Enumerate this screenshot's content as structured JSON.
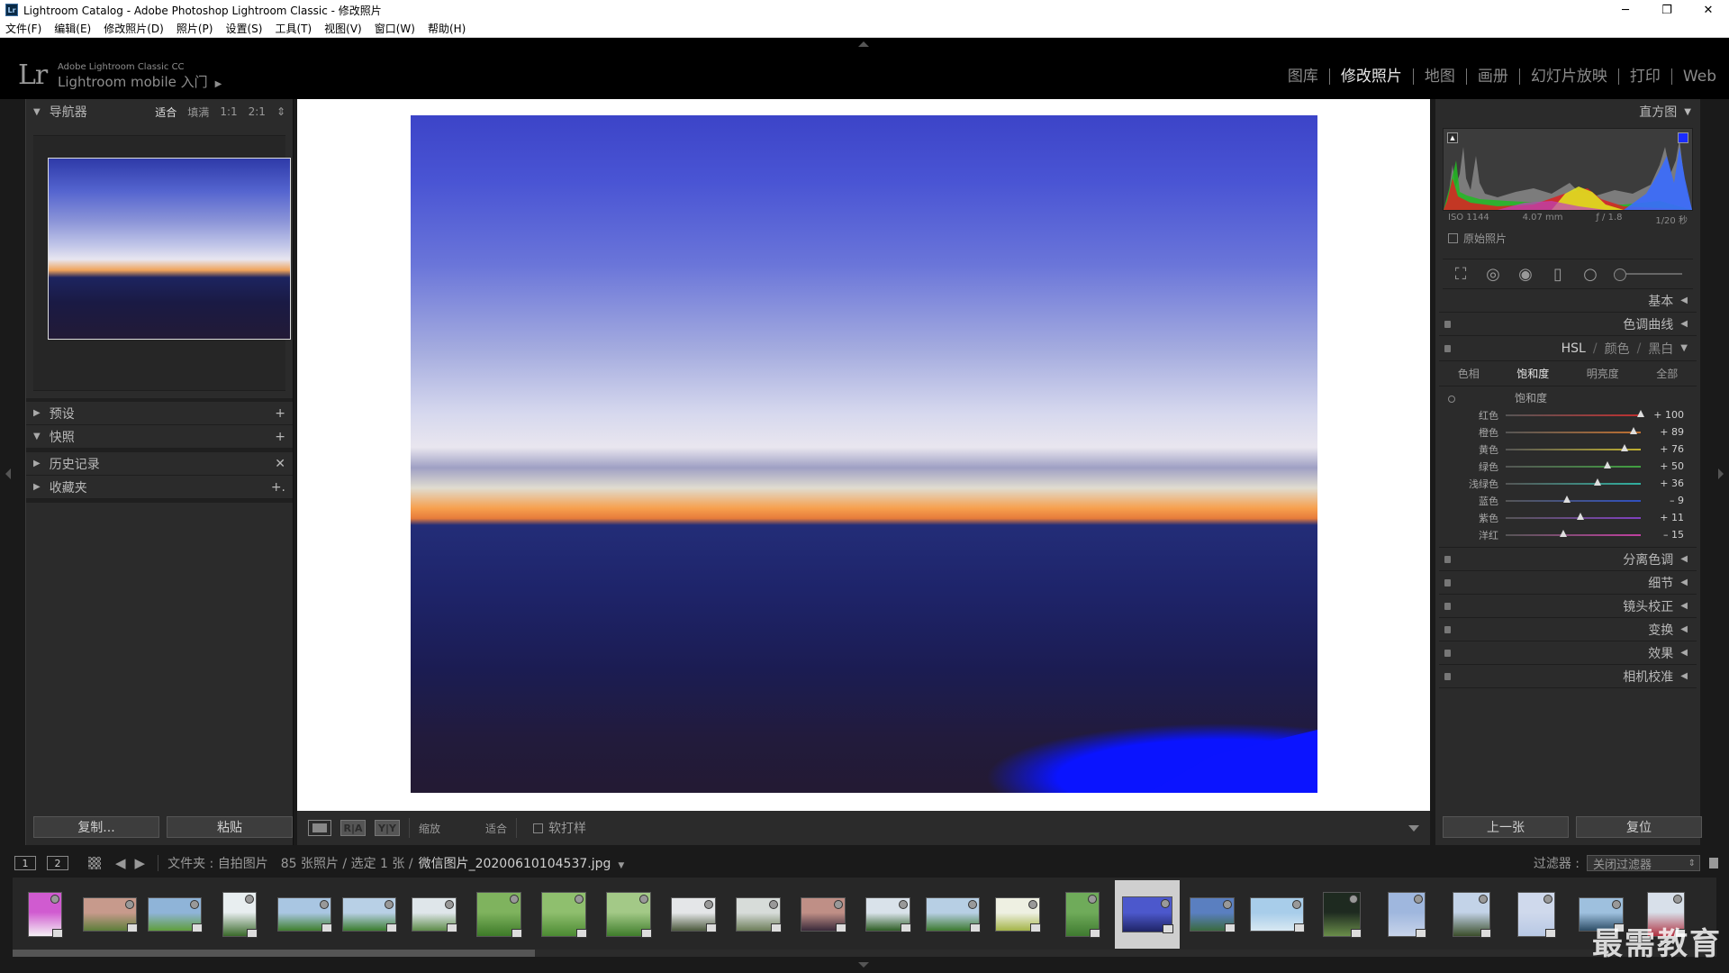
{
  "window": {
    "badge": "Lr",
    "title": "Lightroom Catalog - Adobe Photoshop Lightroom Classic - 修改照片",
    "min": "─",
    "max": "❐",
    "close": "✕"
  },
  "menu": [
    "文件(F)",
    "编辑(E)",
    "修改照片(D)",
    "照片(P)",
    "设置(S)",
    "工具(T)",
    "视图(V)",
    "窗口(W)",
    "帮助(H)"
  ],
  "identity": {
    "logo": "Lr",
    "line1": "Adobe Lightroom Classic CC",
    "line2": "Lightroom mobile 入门",
    "arrow": "▶"
  },
  "modules": [
    {
      "label": "图库",
      "active": false
    },
    {
      "label": "修改照片",
      "active": true
    },
    {
      "label": "地图",
      "active": false
    },
    {
      "label": "画册",
      "active": false
    },
    {
      "label": "幻灯片放映",
      "active": false
    },
    {
      "label": "打印",
      "active": false
    },
    {
      "label": "Web",
      "active": false
    }
  ],
  "left": {
    "navigator": {
      "title": "导航器",
      "tri": "▼",
      "opts": [
        "适合",
        "填满",
        "1:1",
        "2:1"
      ],
      "spin": "⇕"
    },
    "sections": [
      {
        "title": "预设",
        "tri": "▶",
        "action": "+"
      },
      {
        "title": "快照",
        "tri": "▼",
        "action": "+"
      },
      {
        "title": "历史记录",
        "tri": "▶",
        "action": "✕"
      },
      {
        "title": "收藏夹",
        "tri": "▶",
        "action": "+."
      }
    ],
    "copy_button": "复制...",
    "paste_button": "粘贴"
  },
  "toolbar": {
    "box1": "R|A",
    "box2": "Y|Y",
    "zoom_label": "缩放",
    "zoom_value": "适合",
    "softproof": "软打样"
  },
  "right": {
    "histogram": {
      "title": "直方图",
      "tri": "▼",
      "iso": "ISO 1144",
      "focal": "4.07 mm",
      "aperture": "ƒ / 1.8",
      "shutter": "1/20 秒",
      "original": "原始照片"
    },
    "sections_top": [
      {
        "title": "基本",
        "tri": "◀"
      },
      {
        "title": "色调曲线",
        "tri": "◀"
      }
    ],
    "hsl": {
      "labels": [
        "HSL",
        "颜色",
        "黑白"
      ],
      "tri": "▼",
      "tabs": [
        "色相",
        "饱和度",
        "明亮度",
        "全部"
      ],
      "active_tab": 1,
      "sub": "饱和度",
      "sliders": [
        {
          "label": "红色",
          "value": "+ 100",
          "v": 100,
          "color": "#c03030"
        },
        {
          "label": "橙色",
          "value": "+ 89",
          "v": 89,
          "color": "#c07030"
        },
        {
          "label": "黄色",
          "value": "+ 76",
          "v": 76,
          "color": "#c0b030"
        },
        {
          "label": "绿色",
          "value": "+ 50",
          "v": 50,
          "color": "#40a040"
        },
        {
          "label": "浅绿色",
          "value": "+ 36",
          "v": 36,
          "color": "#30b0a0"
        },
        {
          "label": "蓝色",
          "value": "– 9",
          "v": -9,
          "color": "#3050c0"
        },
        {
          "label": "紫色",
          "value": "+ 11",
          "v": 11,
          "color": "#8040c0"
        },
        {
          "label": "洋红",
          "value": "– 15",
          "v": -15,
          "color": "#c040a0"
        }
      ]
    },
    "sections_bottom": [
      {
        "title": "分离色调",
        "tri": "◀"
      },
      {
        "title": "细节",
        "tri": "◀"
      },
      {
        "title": "镜头校正",
        "tri": "◀"
      },
      {
        "title": "变换",
        "tri": "◀"
      },
      {
        "title": "效果",
        "tri": "◀"
      },
      {
        "title": "相机校准",
        "tri": "◀"
      }
    ],
    "prev_button": "上一张",
    "reset_button": "复位"
  },
  "filmstrip_header": {
    "screen1": "1",
    "screen2": "2",
    "back": "◀",
    "forward": "▶",
    "path": "文件夹 : 自拍图片",
    "count": "85 张照片 / 选定 1 张 /",
    "file": "微信图片_20200610104537.jpg",
    "file_tri": "▼",
    "filter_label": "过滤器 :",
    "filter_value": "关闭过滤器",
    "filter_spin": "⇕"
  },
  "filmstrip": {
    "selected_index": 17,
    "thumbs": [
      {
        "w": 38,
        "h": 50,
        "c1": "#d05bd0",
        "c2": "#f4f0f4"
      },
      {
        "w": 60,
        "h": 38,
        "c1": "#c79a8c",
        "c2": "#5d7e3a"
      },
      {
        "w": 60,
        "h": 38,
        "c1": "#8fb4d8",
        "c2": "#5f9e3c"
      },
      {
        "w": 38,
        "h": 50,
        "c1": "#e8eef0",
        "c2": "#3a6a2a"
      },
      {
        "w": 60,
        "h": 38,
        "c1": "#a9c6e2",
        "c2": "#3f7f2e"
      },
      {
        "w": 60,
        "h": 38,
        "c1": "#b8d0e6",
        "c2": "#3b7d2f"
      },
      {
        "w": 50,
        "h": 38,
        "c1": "#dfe6ea",
        "c2": "#5e8c4a"
      },
      {
        "w": 50,
        "h": 50,
        "c1": "#7fb35e",
        "c2": "#3d7a28"
      },
      {
        "w": 50,
        "h": 50,
        "c1": "#8fbf6e",
        "c2": "#4b8a32"
      },
      {
        "w": 50,
        "h": 50,
        "c1": "#a3c987",
        "c2": "#3f7d2b"
      },
      {
        "w": 50,
        "h": 38,
        "c1": "#e4e6e8",
        "c2": "#4d5a3e"
      },
      {
        "w": 50,
        "h": 38,
        "c1": "#d7dcd9",
        "c2": "#6d7e5a"
      },
      {
        "w": 50,
        "h": 38,
        "c1": "#bf8f86",
        "c2": "#3a2a3a"
      },
      {
        "w": 50,
        "h": 38,
        "c1": "#d9e2ea",
        "c2": "#2f5e26"
      },
      {
        "w": 60,
        "h": 38,
        "c1": "#b7cfe4",
        "c2": "#3d7a30"
      },
      {
        "w": 50,
        "h": 38,
        "c1": "#eef0e2",
        "c2": "#a4b448"
      },
      {
        "w": 38,
        "h": 50,
        "c1": "#6fab5a",
        "c2": "#3f7a30"
      },
      {
        "w": 56,
        "h": 40,
        "c1": "#4c58cc",
        "c2": "#1f2466"
      },
      {
        "w": 50,
        "h": 38,
        "c1": "#5a7fc0",
        "c2": "#3a6a40"
      },
      {
        "w": 60,
        "h": 38,
        "c1": "#a8cdea",
        "c2": "#d8e8f2"
      },
      {
        "w": 42,
        "h": 50,
        "c1": "#1e2a20",
        "c2": "#6a8e4a"
      },
      {
        "w": 42,
        "h": 50,
        "c1": "#9fb7de",
        "c2": "#c8d4ea"
      },
      {
        "w": 42,
        "h": 50,
        "c1": "#c3d3e8",
        "c2": "#3b4e2a"
      },
      {
        "w": 42,
        "h": 50,
        "c1": "#cfd9ec",
        "c2": "#b8c8e4"
      },
      {
        "w": 50,
        "h": 38,
        "c1": "#9ec0de",
        "c2": "#2d4d66"
      },
      {
        "w": 42,
        "h": 50,
        "c1": "#d8e0ea",
        "c2": "#b03040"
      }
    ]
  },
  "watermark": "最需教育"
}
